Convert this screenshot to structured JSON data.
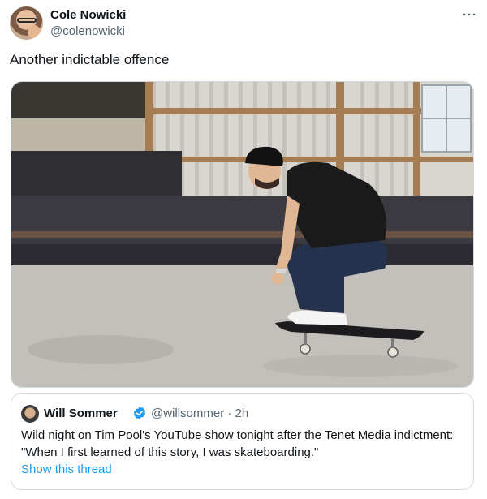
{
  "author": {
    "name": "Cole Nowicki",
    "handle": "@colenowicki",
    "avatar_icon": "user-avatar"
  },
  "menu": {
    "more_label": "···"
  },
  "tweet": {
    "text": "Another indictable offence"
  },
  "media": {
    "kind": "image",
    "subject": "skateboarding-photo"
  },
  "quoted_tweet": {
    "author_name": "Will Sommer",
    "verified": true,
    "handle_time": "@willsommer · 2h",
    "text": "Wild night on Tim Pool's YouTube show tonight after the Tenet Media indictment: \"When I first learned of this story, I was skateboarding.\"",
    "show_thread_label": "Show this thread"
  },
  "colors": {
    "text_primary": "#0f1419",
    "text_secondary": "#536471",
    "link": "#1d9bf0",
    "border": "#cfd9de",
    "verified": "#1d9bf0"
  }
}
